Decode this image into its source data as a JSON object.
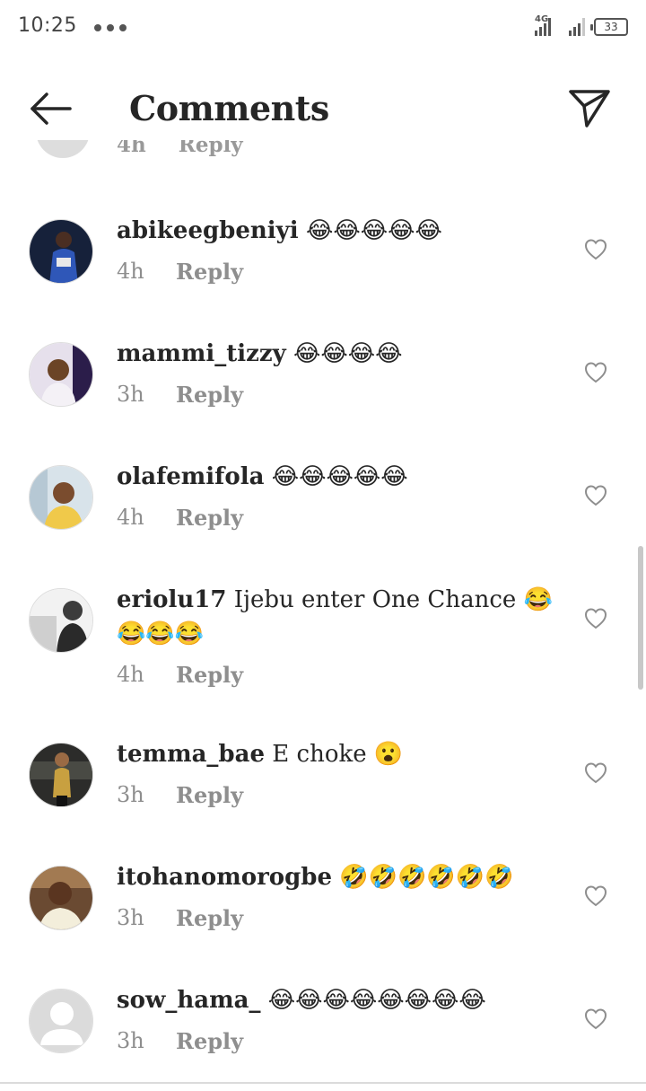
{
  "status_bar": {
    "time": "10:25",
    "network": "4G",
    "battery": "33"
  },
  "header": {
    "title": "Comments"
  },
  "ghost_row": {
    "time": "4h",
    "reply": "Reply"
  },
  "comments": [
    {
      "username": "abikeegbeniyi",
      "text": "😂😂😂😂😂",
      "time": "4h",
      "reply": "Reply",
      "avatar_color": "#2b3a6b"
    },
    {
      "username": "mammi_tizzy",
      "text": "😂😂😂😂",
      "time": "3h",
      "reply": "Reply",
      "avatar_color": "#5a3f7a"
    },
    {
      "username": "olafemifola",
      "text": "😂😂😂😂😂",
      "time": "4h",
      "reply": "Reply",
      "avatar_color": "#c9b99a"
    },
    {
      "username": "eriolu17",
      "text": "Ijebu enter One Chance 😂😂😂😂",
      "time": "4h",
      "reply": "Reply",
      "avatar_color": "#666666"
    },
    {
      "username": "temma_bae",
      "text": "E choke 😮",
      "time": "3h",
      "reply": "Reply",
      "avatar_color": "#3b3a36"
    },
    {
      "username": "itohanomorogbe",
      "text": "🤣🤣🤣🤣🤣🤣",
      "time": "3h",
      "reply": "Reply",
      "avatar_color": "#8a5a3a"
    },
    {
      "username": "sow_hama_",
      "text": "😂😂😂😂😂😂😂😂",
      "time": "3h",
      "reply": "Reply",
      "avatar_color": "#dadada"
    }
  ],
  "icons": {
    "back": "arrow-left-icon",
    "send": "paper-plane-icon",
    "like": "heart-outline-icon"
  }
}
